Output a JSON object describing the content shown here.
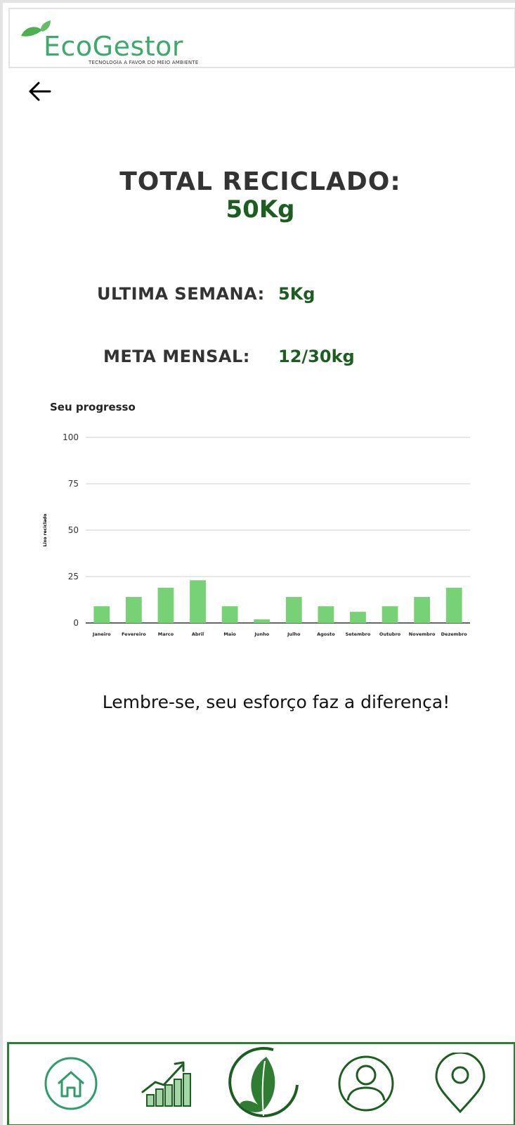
{
  "header": {
    "logo_text": "EcoGestor",
    "tagline": "TECNOLOGIA A FAVOR DO MEIO AMBIENTE"
  },
  "back_icon": "arrow-left-icon",
  "summary": {
    "total_label": "TOTAL RECICLADO:",
    "total_value": "50Kg",
    "week_label": "ULTIMA SEMANA:",
    "week_value": "5Kg",
    "goal_label": "META MENSAL:",
    "goal_value": "12/30kg"
  },
  "chart_data": {
    "type": "bar",
    "title": "Seu progresso",
    "ylabel": "Lixo reciclado",
    "xlabel": "",
    "categories": [
      "Janeiro",
      "Fevereiro",
      "Marco",
      "Abril",
      "Maio",
      "Junho",
      "Julho",
      "Agosto",
      "Setembro",
      "Outubro",
      "Novembro",
      "Dezembro"
    ],
    "values": [
      9,
      14,
      19,
      23,
      9,
      2,
      14,
      9,
      6,
      9,
      14,
      19
    ],
    "ylim": [
      0,
      100
    ],
    "yticks": [
      0,
      25,
      50,
      75,
      100
    ],
    "grid": true,
    "bar_color": "#76d275",
    "grid_color": "#cccccc"
  },
  "motto": "Lembre-se, seu esforço faz a diferença!",
  "nav": {
    "items": [
      {
        "icon": "home-icon"
      },
      {
        "icon": "growth-chart-icon"
      },
      {
        "icon": "leaf-icon"
      },
      {
        "icon": "user-icon"
      },
      {
        "icon": "location-pin-icon"
      }
    ],
    "accent": "#2e7d32"
  }
}
